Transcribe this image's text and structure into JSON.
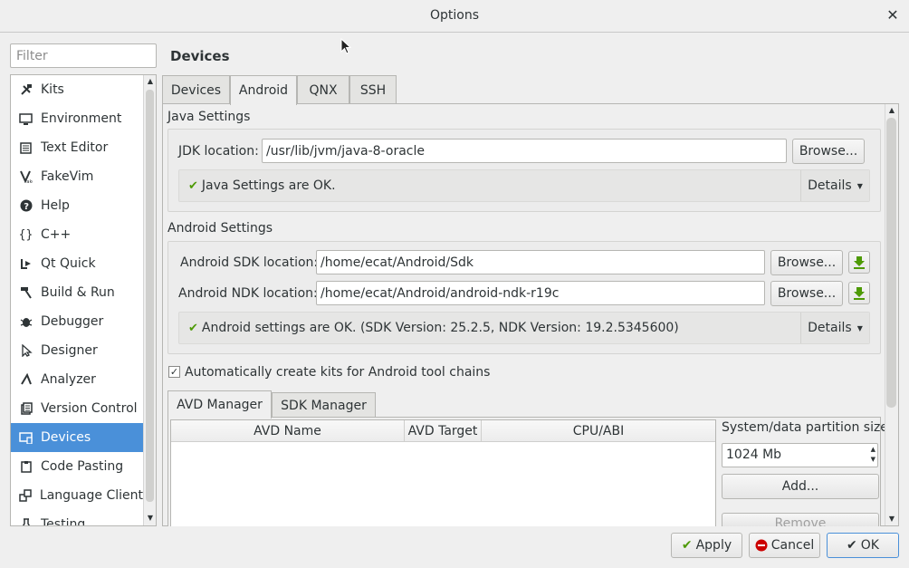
{
  "window": {
    "title": "Options",
    "close_glyph": "✕"
  },
  "filter": {
    "placeholder": "Filter",
    "value": ""
  },
  "sidebar": {
    "items": [
      {
        "label": "Kits",
        "icon": "kits-icon"
      },
      {
        "label": "Environment",
        "icon": "monitor-icon"
      },
      {
        "label": "Text Editor",
        "icon": "text-editor-icon"
      },
      {
        "label": "FakeVim",
        "icon": "fakevim-icon"
      },
      {
        "label": "Help",
        "icon": "help-icon"
      },
      {
        "label": "C++",
        "icon": "braces-icon"
      },
      {
        "label": "Qt Quick",
        "icon": "qt-quick-icon"
      },
      {
        "label": "Build & Run",
        "icon": "hammer-icon"
      },
      {
        "label": "Debugger",
        "icon": "bug-icon"
      },
      {
        "label": "Designer",
        "icon": "designer-icon"
      },
      {
        "label": "Analyzer",
        "icon": "analyzer-icon"
      },
      {
        "label": "Version Control",
        "icon": "version-control-icon"
      },
      {
        "label": "Devices",
        "icon": "devices-icon",
        "selected": true
      },
      {
        "label": "Code Pasting",
        "icon": "code-pasting-icon"
      },
      {
        "label": "Language Client",
        "icon": "language-client-icon"
      },
      {
        "label": "Testing",
        "icon": "testing-icon"
      }
    ],
    "selected_color": "#4a90d9"
  },
  "page": {
    "title": "Devices"
  },
  "tabs": [
    {
      "label": "Devices"
    },
    {
      "label": "Android",
      "active": true
    },
    {
      "label": "QNX"
    },
    {
      "label": "SSH"
    }
  ],
  "java": {
    "section_title": "Java Settings",
    "jdk_label": "JDK location:",
    "jdk_value": "/usr/lib/jvm/java-8-oracle",
    "browse_label": "Browse...",
    "status": "Java Settings are OK.",
    "details_label": "Details"
  },
  "android": {
    "section_title": "Android Settings",
    "sdk_label": "Android SDK location:",
    "sdk_value": "/home/ecat/Android/Sdk",
    "ndk_label": "Android NDK location:",
    "ndk_value": "/home/ecat/Android/android-ndk-r19c",
    "browse_label": "Browse...",
    "status": "Android settings are OK. (SDK Version: 25.2.5, NDK Version: 19.2.5345600)",
    "details_label": "Details",
    "auto_kits_label": "Automatically create kits for Android tool chains",
    "auto_kits_checked": true
  },
  "avd": {
    "tabs": [
      {
        "label": "AVD Manager",
        "active": true
      },
      {
        "label": "SDK Manager"
      }
    ],
    "columns": [
      "AVD Name",
      "AVD Target",
      "CPU/ABI"
    ],
    "partition_label": "System/data partition size:",
    "partition_value": "1024 Mb",
    "add_label": "Add...",
    "remove_label": "Remove"
  },
  "buttons": {
    "apply": "Apply",
    "cancel": "Cancel",
    "ok": "OK"
  },
  "colors": {
    "ok_check": "#4e9a06",
    "download_green": "#4e9a06",
    "cancel_red": "#cc0000"
  }
}
